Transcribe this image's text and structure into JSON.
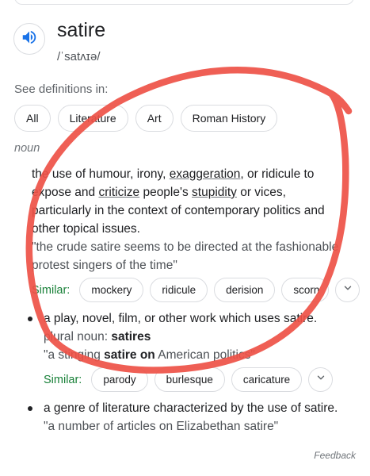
{
  "entry": {
    "word": "satire",
    "phonetic": "/ˈsatʌɪə/"
  },
  "see_definitions": {
    "label": "See definitions in:",
    "chips": [
      "All",
      "Literature",
      "Art",
      "Roman History"
    ]
  },
  "part_of_speech": "noun",
  "senses": [
    {
      "definition_lines": [
        [
          "the use of humour, irony, ",
          "exaggeration",
          ", or ridicule to"
        ],
        [
          "expose and ",
          "criticize",
          " people's ",
          "stupidity",
          " or vices,"
        ],
        [
          "particularly in the context of contemporary politics and"
        ],
        [
          "other topical issues."
        ]
      ],
      "example_lines": [
        "\"the crude satire seems to be directed at the fashionable",
        "protest singers of the time\""
      ],
      "similar_label": "Similar:",
      "similar": [
        "mockery",
        "ridicule",
        "derision",
        "scorn"
      ]
    },
    {
      "definition": "a play, novel, film, or other work which uses satire.",
      "plural_label": "plural noun:",
      "plural": "satires",
      "example": [
        "\"a stinging ",
        "satire on",
        " American politics\""
      ],
      "similar_label": "Similar:",
      "similar": [
        "parody",
        "burlesque",
        "caricature"
      ]
    },
    {
      "definition": "a genre of literature characterized by the use of satire.",
      "example": "\"a number of articles on Elizabethan satire\""
    }
  ],
  "feedback": "Feedback",
  "colors": {
    "speaker_icon": "#1a73e8",
    "similar_label": "#188038",
    "annotation": "#ee5146"
  }
}
